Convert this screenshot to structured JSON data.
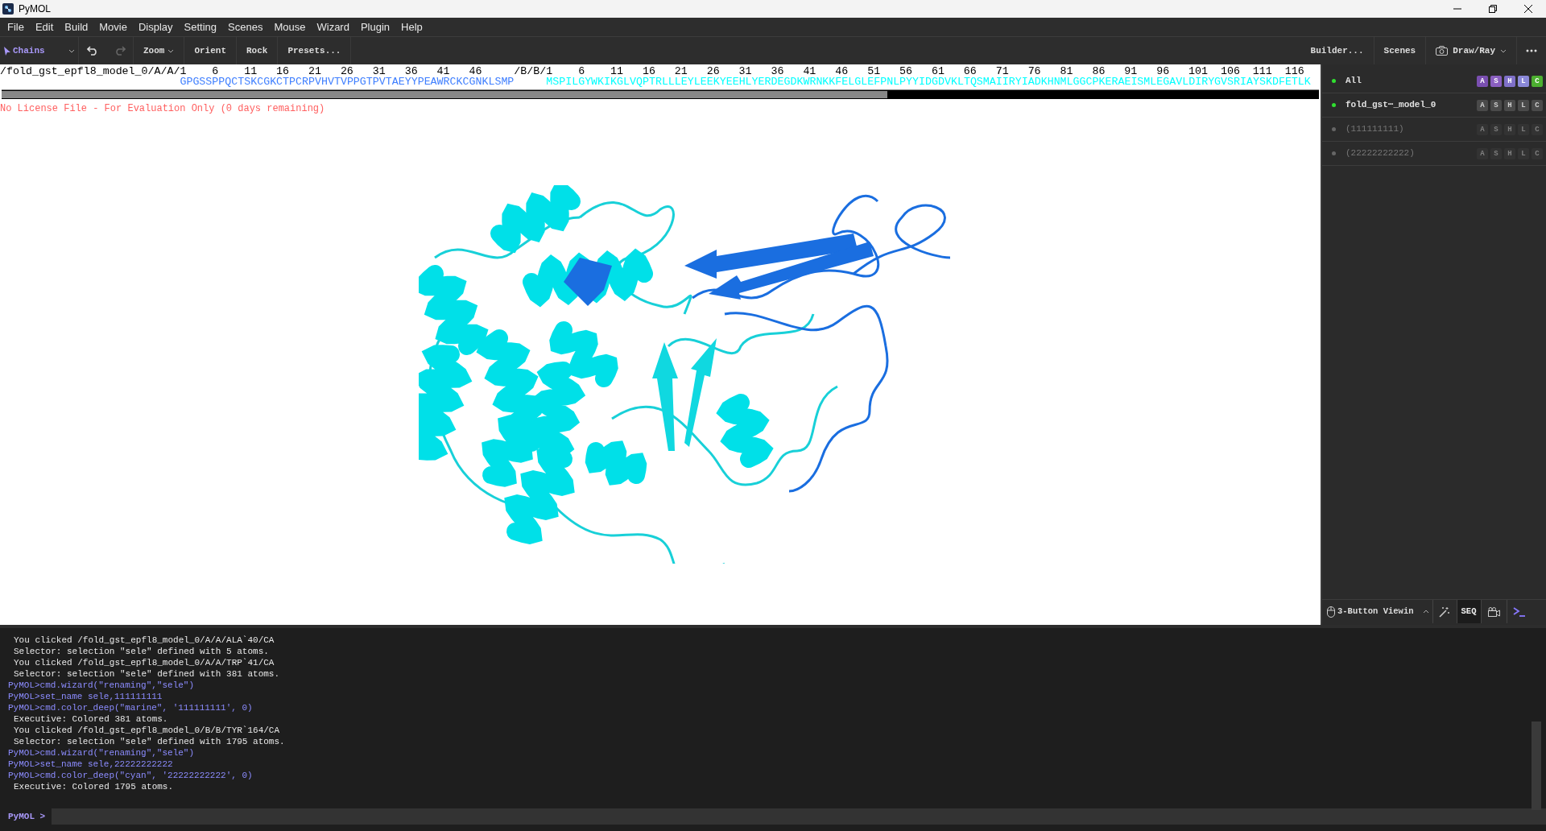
{
  "window": {
    "title": "PyMOL"
  },
  "menu": [
    "File",
    "Edit",
    "Build",
    "Movie",
    "Display",
    "Setting",
    "Scenes",
    "Mouse",
    "Wizard",
    "Plugin",
    "Help"
  ],
  "toolbar": {
    "mode": "Chains",
    "redo_disabled": true,
    "zoom": "Zoom",
    "buttons": [
      "Orient",
      "Rock",
      "Presets..."
    ],
    "right_buttons": [
      "Builder...",
      "Scenes"
    ],
    "draw": "Draw/Ray"
  },
  "sequence": [
    {
      "label": "/fold_gst_epfl8_model_0/A/A/1",
      "ticks": [
        "6",
        "11",
        "16",
        "21",
        "26",
        "31",
        "36",
        "41",
        "46"
      ],
      "residues": "GPGSSPPQCTSKCGKCTPCRPVHVTVPPGTPVTAEYYPEAWRCKCGNKLSMP",
      "color": "#3f7fff"
    },
    {
      "label": "/B/B/1",
      "ticks": [
        "6",
        "11",
        "16",
        "21",
        "26",
        "31",
        "36",
        "41",
        "46",
        "51",
        "56",
        "61",
        "66",
        "71",
        "76",
        "81",
        "86",
        "91",
        "96",
        "101",
        "106",
        "111",
        "116"
      ],
      "residues": "MSPILGYWKIKGLVQPTRLLLEYLEEKYEEHLYERDEGDKWRNKKFELGLEFPNLPYYIDGDVKLTQSMAIIRYIADKHNMLGGCPKERAEISMLEGAVLDIRYGVSRIAYSKDFETLK",
      "color": "#00ffff"
    }
  ],
  "license": "No License File - For Evaluation Only (0 days remaining)",
  "objects": [
    {
      "kind": "all",
      "name": "All",
      "enabled": true,
      "buttons": [
        "A",
        "S",
        "H",
        "L",
        "C"
      ]
    },
    {
      "kind": "object",
      "name": "fold_gst┅_model_0",
      "enabled": true,
      "buttons": [
        "A",
        "S",
        "H",
        "L",
        "C"
      ]
    },
    {
      "kind": "selection",
      "name": "(111111111)",
      "enabled": false,
      "buttons": [
        "A",
        "S",
        "H",
        "L",
        "C"
      ]
    },
    {
      "kind": "selection",
      "name": "(22222222222)",
      "enabled": false,
      "buttons": [
        "A",
        "S",
        "H",
        "L",
        "C"
      ]
    }
  ],
  "bottom_bar": {
    "mouse_mode": "3-Button Viewin",
    "seq": "SEQ",
    "seq_on": true
  },
  "console": [
    {
      "kind": "output",
      "text": "You clicked /fold_gst_epfl8_model_0/A/A/ALA`40/CA"
    },
    {
      "kind": "output",
      "text": "Selector: selection \"sele\" defined with 5 atoms."
    },
    {
      "kind": "output",
      "text": "You clicked /fold_gst_epfl8_model_0/A/A/TRP`41/CA"
    },
    {
      "kind": "output",
      "text": "Selector: selection \"sele\" defined with 381 atoms."
    },
    {
      "kind": "command",
      "text": "PyMOL>cmd.wizard(\"renaming\",\"sele\")"
    },
    {
      "kind": "command",
      "text": "PyMOL>set_name sele,111111111"
    },
    {
      "kind": "command",
      "text": "PyMOL>cmd.color_deep(\"marine\", '111111111', 0)"
    },
    {
      "kind": "output",
      "text": "Executive: Colored 381 atoms."
    },
    {
      "kind": "output",
      "text": "You clicked /fold_gst_epfl8_model_0/B/B/TYR`164/CA"
    },
    {
      "kind": "output",
      "text": "Selector: selection \"sele\" defined with 1795 atoms."
    },
    {
      "kind": "command",
      "text": "PyMOL>cmd.wizard(\"renaming\",\"sele\")"
    },
    {
      "kind": "command",
      "text": "PyMOL>set_name sele,22222222222"
    },
    {
      "kind": "command",
      "text": "PyMOL>cmd.color_deep(\"cyan\", '22222222222', 0)"
    },
    {
      "kind": "output",
      "text": "Executive: Colored 1795 atoms."
    }
  ],
  "prompt": "PyMOL >"
}
